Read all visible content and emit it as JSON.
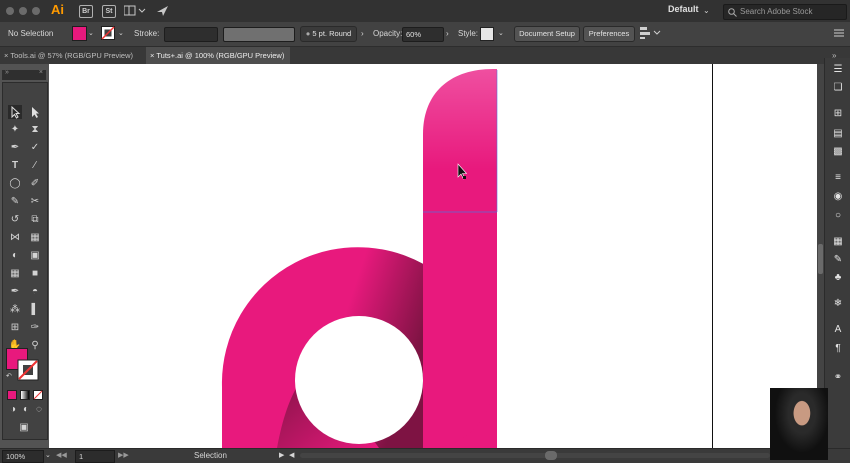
{
  "app": {
    "logo_text": "Ai",
    "bridge": "Br",
    "stock": "St",
    "workspace": "Default",
    "search_placeholder": "Search Adobe Stock"
  },
  "control_bar": {
    "selection_label": "No Selection",
    "stroke_label": "Stroke:",
    "brush_value": "5 pt. Round",
    "opacity_label": "Opacity:",
    "opacity_value": "60%",
    "style_label": "Style:",
    "document_setup": "Document Setup",
    "preferences": "Preferences",
    "fill_color": "#e8197d"
  },
  "tabs": [
    {
      "label": "Tools.ai @ 57% (RGB/GPU Preview)"
    },
    {
      "label": "Tuts+.ai @ 100% (RGB/GPU Preview)"
    }
  ],
  "status_bar": {
    "zoom": "100%",
    "artboard_number": "1",
    "current_tool": "Selection"
  },
  "artwork": {
    "shape": "lowercase d",
    "color_main": "#e8197d",
    "color_dark": "#7e1343",
    "color_light": "#ef4fa0"
  }
}
